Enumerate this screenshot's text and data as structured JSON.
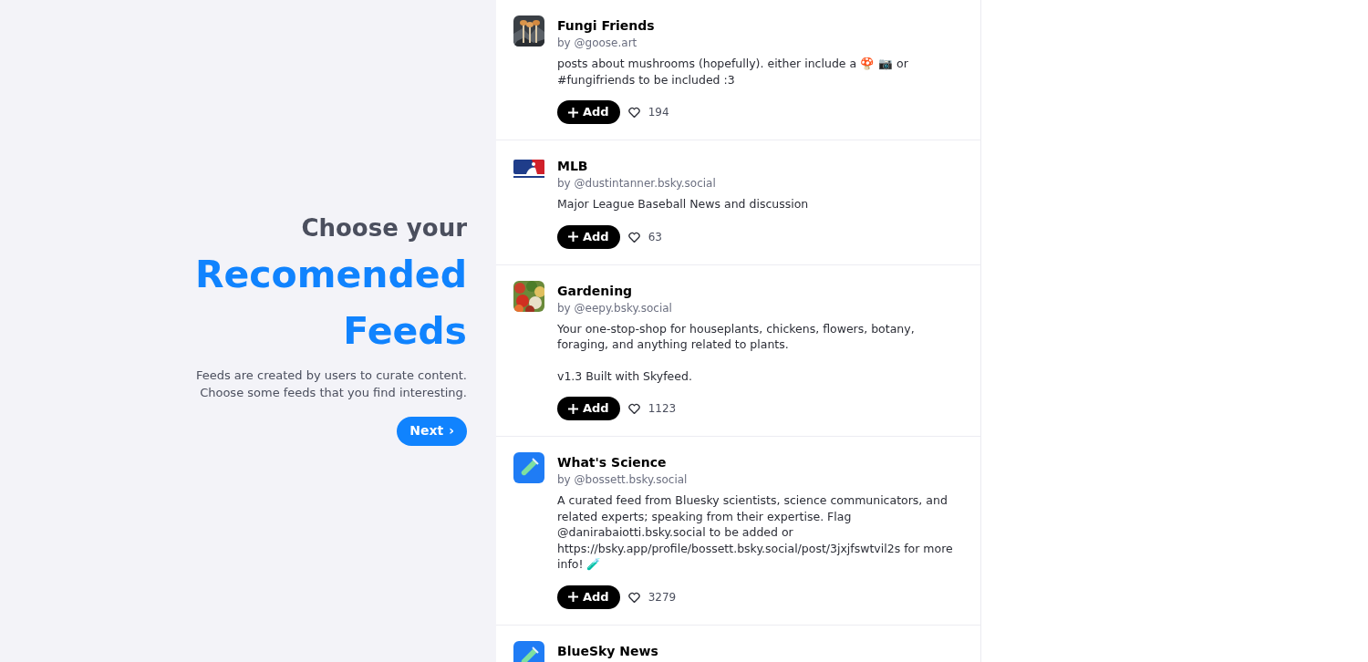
{
  "intro": {
    "title_line": "Choose your",
    "headline": [
      "Recomended",
      "Feeds"
    ],
    "description": [
      "Feeds are created by users to curate content.",
      "Choose some feeds that you find interesting."
    ],
    "next_button": {
      "label": "Next",
      "icon": "›"
    }
  },
  "feeds": [
    {
      "avatar": {
        "kind": "fungi"
      },
      "name": "Fungi Friends",
      "author": "by @goose.art",
      "description": [
        "posts about mushrooms (hopefully). either include a 🍄 📷 or #fungifriends to be included :3"
      ],
      "add_label": "Add",
      "likes": "194"
    },
    {
      "avatar": {
        "kind": "logo"
      },
      "name": "MLB",
      "author": "by @dustintanner.bsky.social",
      "description": [
        "Major League Baseball News and discussion"
      ],
      "add_label": "Add",
      "likes": "63"
    },
    {
      "avatar": {
        "kind": "produce"
      },
      "name": "Gardening",
      "author": "by @eepy.bsky.social",
      "description": [
        "Your one-stop-shop for houseplants, chickens, flowers, botany, foraging, and anything related to plants.",
        "v1.3 Built with Skyfeed."
      ],
      "add_label": "Add",
      "likes": "1123"
    },
    {
      "avatar": {
        "kind": "tube"
      },
      "name": "What's Science",
      "author": "by @bossett.bsky.social",
      "description": [
        "A curated feed from Bluesky scientists, science communicators, and related experts; speaking from their expertise. Flag @danirabaiotti.bsky.social to be added or https://bsky.app/profile/bossett.bsky.social/post/3jxjfswtvil2s for more info! 🧪"
      ],
      "add_label": "Add",
      "likes": "3279"
    },
    {
      "avatar": {
        "kind": "tube"
      },
      "name": "BlueSky News"
    }
  ]
}
